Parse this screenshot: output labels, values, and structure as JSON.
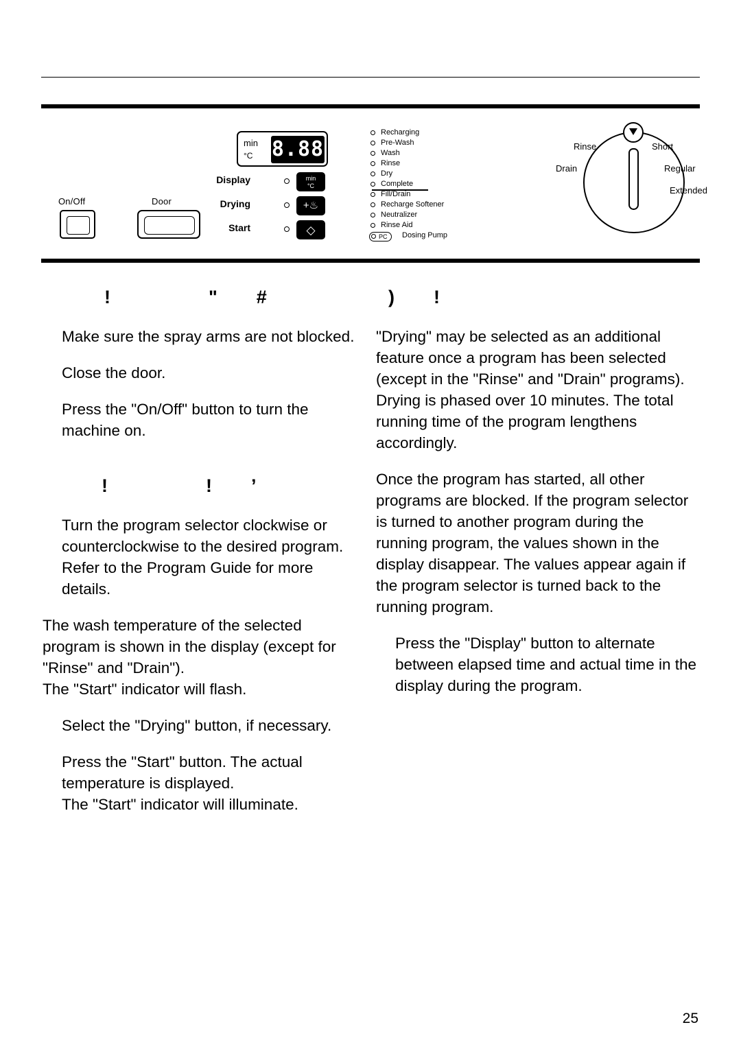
{
  "page": {
    "number": "25"
  },
  "panel": {
    "buttons": {
      "onoff_label": "On/Off",
      "door_label": "Door"
    },
    "display": {
      "unit_min": "min",
      "unit_celsius": "°C",
      "digits": "8.88"
    },
    "controls": [
      {
        "label": "Display",
        "icon": "display-button-icon",
        "icon_text_top": "min",
        "icon_text_bottom": "°C"
      },
      {
        "label": "Drying",
        "icon": "drying-button-icon",
        "icon_glyph": "+♨"
      },
      {
        "label": "Start",
        "icon": "start-button-icon",
        "icon_glyph": "◇"
      }
    ],
    "indicators": [
      "Recharging",
      "Pre-Wash",
      "Wash",
      "Rinse",
      "Dry",
      "Complete",
      "Fill/Drain",
      "Recharge Softener",
      "Neutralizer",
      "Rinse Aid"
    ],
    "dosing_pump": {
      "badge": "PC",
      "label": "Dosing Pump"
    },
    "dial": {
      "labels": {
        "rinse": "Rinse",
        "short": "Short",
        "drain": "Drain",
        "regular": "Regular",
        "extended": "Extended"
      }
    }
  },
  "left_column": {
    "heading_1": "!      \"  #",
    "p1": "Make sure the spray arms are not blocked.",
    "p2": "Close the door.",
    "p3": "Press the \"On/Off\" button to turn the machine on.",
    "heading_2": "!      !  ’",
    "p4": "Turn the program selector clockwise or counterclockwise to the desired program. Refer to the Program Guide for more details.",
    "p5": "The wash temperature of the selected program is shown in the display (except for \"Rinse\" and \"Drain\").",
    "p6": "The \"Start\" indicator will flash.",
    "p7": "Select the \"Drying\" button, if necessary.",
    "p8": "Press the \"Start\" button. The actual temperature is displayed.",
    "p9": "The \"Start\" indicator will illuminate."
  },
  "right_column": {
    "heading_1": ")  !",
    "p1": "\"Drying\" may be selected as an additional feature once a program has been selected (except in the \"Rinse\" and \"Drain\" programs). Drying is phased over 10 minutes. The total running time of the program lengthens accordingly.",
    "p2": "Once the program has started, all other programs are blocked. If the program selector is turned to another program during the running program, the values shown in the display disappear. The values appear again if the program selector is turned back to the running program.",
    "p3": "Press the \"Display\" button to alternate between elapsed time and actual time in the display during the program."
  }
}
